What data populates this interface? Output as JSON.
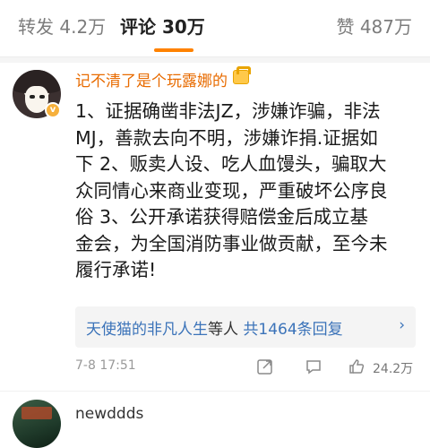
{
  "tabs": {
    "repost": "转发 4.2万",
    "comment": "评论 30万",
    "like": "赞 487万",
    "accent_color": "#ff8200"
  },
  "comment": {
    "username": "记不清了是个玩露娜的",
    "badge_icon": "vip-crown-icon",
    "lines": [
      "1、证据确凿非法JZ，涉嫌诈骗，非法",
      "MJ，善款去向不明，涉嫌诈捐.证据如",
      "下 2、贩卖人设、吃人血馒头，骗取大",
      "众同情心来商业变现，严重破坏公序良",
      "俗  3、公开承诺获得赔偿金后成立基",
      "金会，为全国消防事业做贡献，至今未",
      "履行承诺!"
    ],
    "reply_summary": {
      "name": "天使猫的非凡人生",
      "mid": "等人",
      "count": "共1464条回复",
      "arrow": "›"
    },
    "time": "7-8 17:51",
    "like_count": "24.2万"
  },
  "next_comment": {
    "username": "newddds"
  }
}
